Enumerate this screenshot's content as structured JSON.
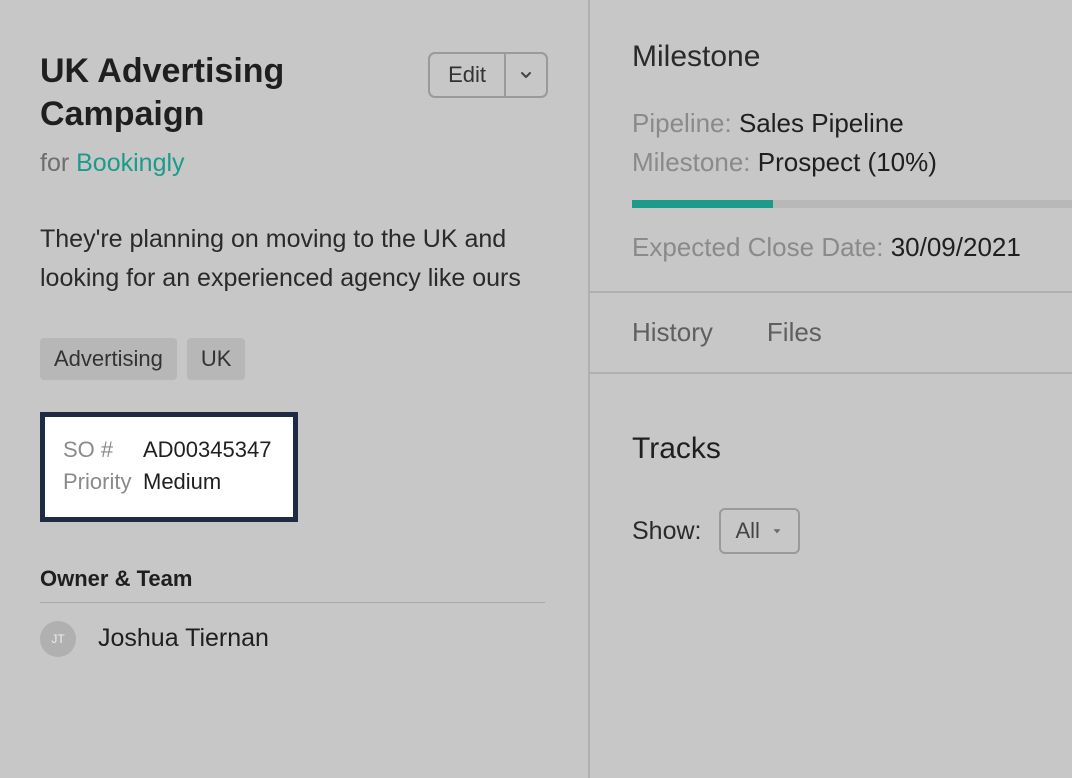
{
  "left": {
    "title": "UK Advertising Campaign",
    "for_prefix": "for ",
    "for_link": "Bookingly",
    "edit_label": "Edit",
    "description": "They're planning on moving to the UK and looking for an experienced agency like ours",
    "tags": [
      "Advertising",
      "UK"
    ],
    "fields": {
      "so_label": "SO #",
      "so_value": "AD00345347",
      "priority_label": "Priority",
      "priority_value": "Medium"
    },
    "owner_section_title": "Owner & Team",
    "owner": {
      "initials": "JT",
      "name": "Joshua Tiernan"
    }
  },
  "right": {
    "milestone_title": "Milestone",
    "pipeline_label": "Pipeline:",
    "pipeline_value": "Sales Pipeline",
    "milestone_label": "Milestone:",
    "milestone_value": "Prospect (10%)",
    "progress_percent": 32,
    "expected_label": "Expected Close Date:",
    "expected_value": "30/09/2021",
    "tabs": [
      "History",
      "Files"
    ],
    "tracks_title": "Tracks",
    "show_label": "Show:",
    "show_value": "All"
  }
}
